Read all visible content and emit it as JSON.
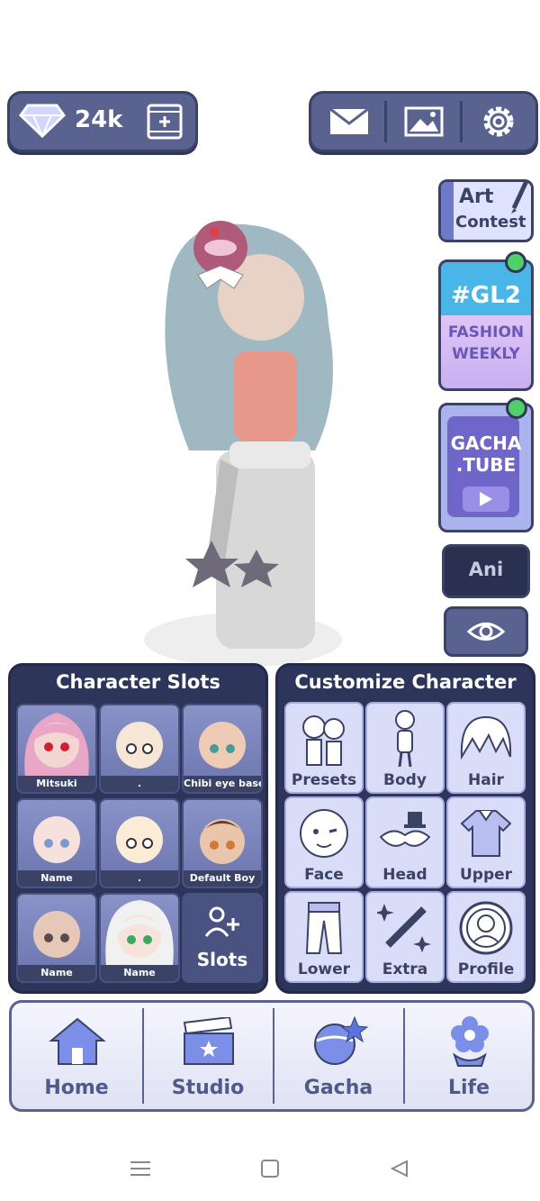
{
  "topbar": {
    "gems": "24k",
    "icons": [
      "diamond-icon",
      "film-add-icon",
      "mail-icon",
      "gallery-icon",
      "gear-icon"
    ]
  },
  "side": {
    "art_contest_line1": "Art",
    "art_contest_line2": "Contest",
    "gl2_title": "#GL2",
    "gl2_line1": "FASHION",
    "gl2_line2": "WEEKLY",
    "gachatube_line1": "GACHA",
    "gachatube_line2": ".TUBE",
    "ani_label": "Ani",
    "eye_icon": "eye-icon"
  },
  "slots": {
    "title": "Character Slots",
    "items": [
      {
        "name": "Mitsuki"
      },
      {
        "name": "."
      },
      {
        "name": "Chibi eye base"
      },
      {
        "name": "Name"
      },
      {
        "name": "."
      },
      {
        "name": "Default Boy"
      },
      {
        "name": "Name"
      },
      {
        "name": "Name"
      }
    ],
    "add_label": "Slots"
  },
  "customize": {
    "title": "Customize Character",
    "items": [
      {
        "label": "Presets"
      },
      {
        "label": "Body"
      },
      {
        "label": "Hair"
      },
      {
        "label": "Face"
      },
      {
        "label": "Head"
      },
      {
        "label": "Upper"
      },
      {
        "label": "Lower"
      },
      {
        "label": "Extra"
      },
      {
        "label": "Profile"
      }
    ]
  },
  "nav": {
    "items": [
      {
        "label": "Home"
      },
      {
        "label": "Studio"
      },
      {
        "label": "Gacha"
      },
      {
        "label": "Life"
      }
    ]
  },
  "colors": {
    "accent": "#5a6390",
    "panel": "#2e355a",
    "tile": "#d9ddf7",
    "notify": "#4fd06a"
  }
}
